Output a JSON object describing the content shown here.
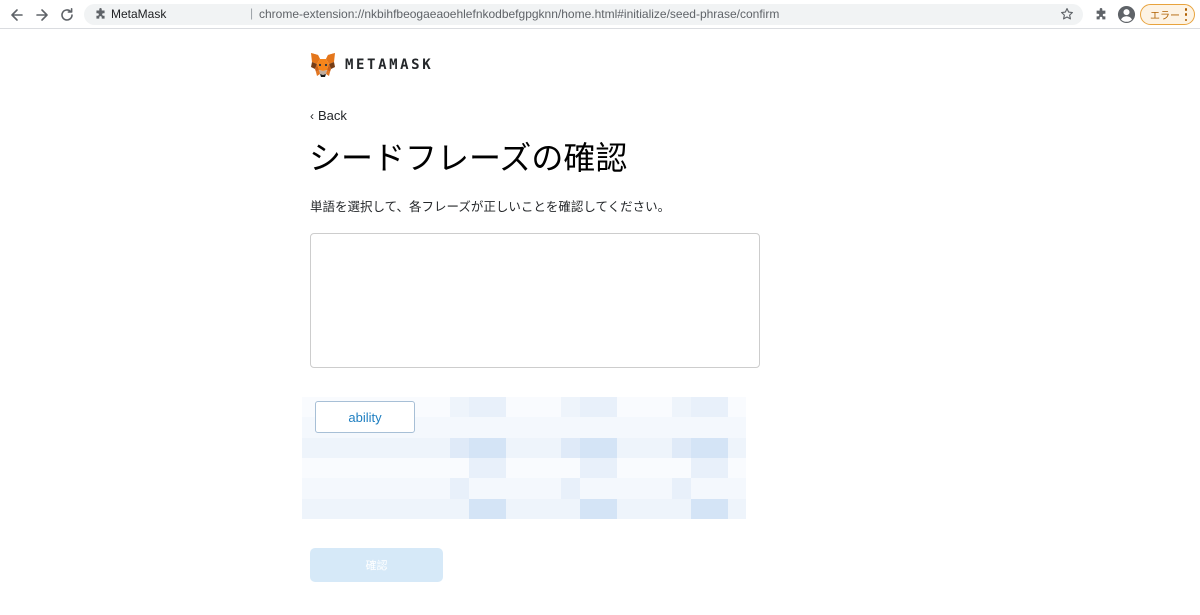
{
  "browser": {
    "site_name": "MetaMask",
    "separator": "|",
    "url": "chrome-extension://nkbihfbeogaeaoehlefnkodbefgpgknn/home.html#initialize/seed-phrase/confirm",
    "error_badge_label": "エラー",
    "icons": {
      "back": "arrow-left-icon",
      "forward": "arrow-right-icon",
      "reload": "reload-icon",
      "omnibox_extension": "puzzle-icon",
      "bookmark": "star-icon",
      "extensions": "puzzle-icon",
      "profile": "account-circle-icon",
      "menu": "kebab-menu-icon"
    },
    "colors": {
      "error_badge_border": "#e8a33d",
      "error_badge_text": "#b06000"
    }
  },
  "logo": {
    "wordmark": "METAMASK",
    "icon": "metamask-fox-icon"
  },
  "back_label": "Back",
  "page_title": "シードフレーズの確認",
  "instruction": "単語を選択して、各フレーズが正しいことを確認してください。",
  "phrase_box_words": [],
  "word_choices": [
    {
      "label": "ability",
      "state": "available"
    }
  ],
  "word_choices_obscured": true,
  "confirm_button": {
    "label": "確認",
    "disabled": true
  },
  "colors": {
    "accent_blue": "#1f7fc1",
    "disabled_button_bg": "#d6e9f8",
    "chip_border": "#a7bfd6"
  }
}
